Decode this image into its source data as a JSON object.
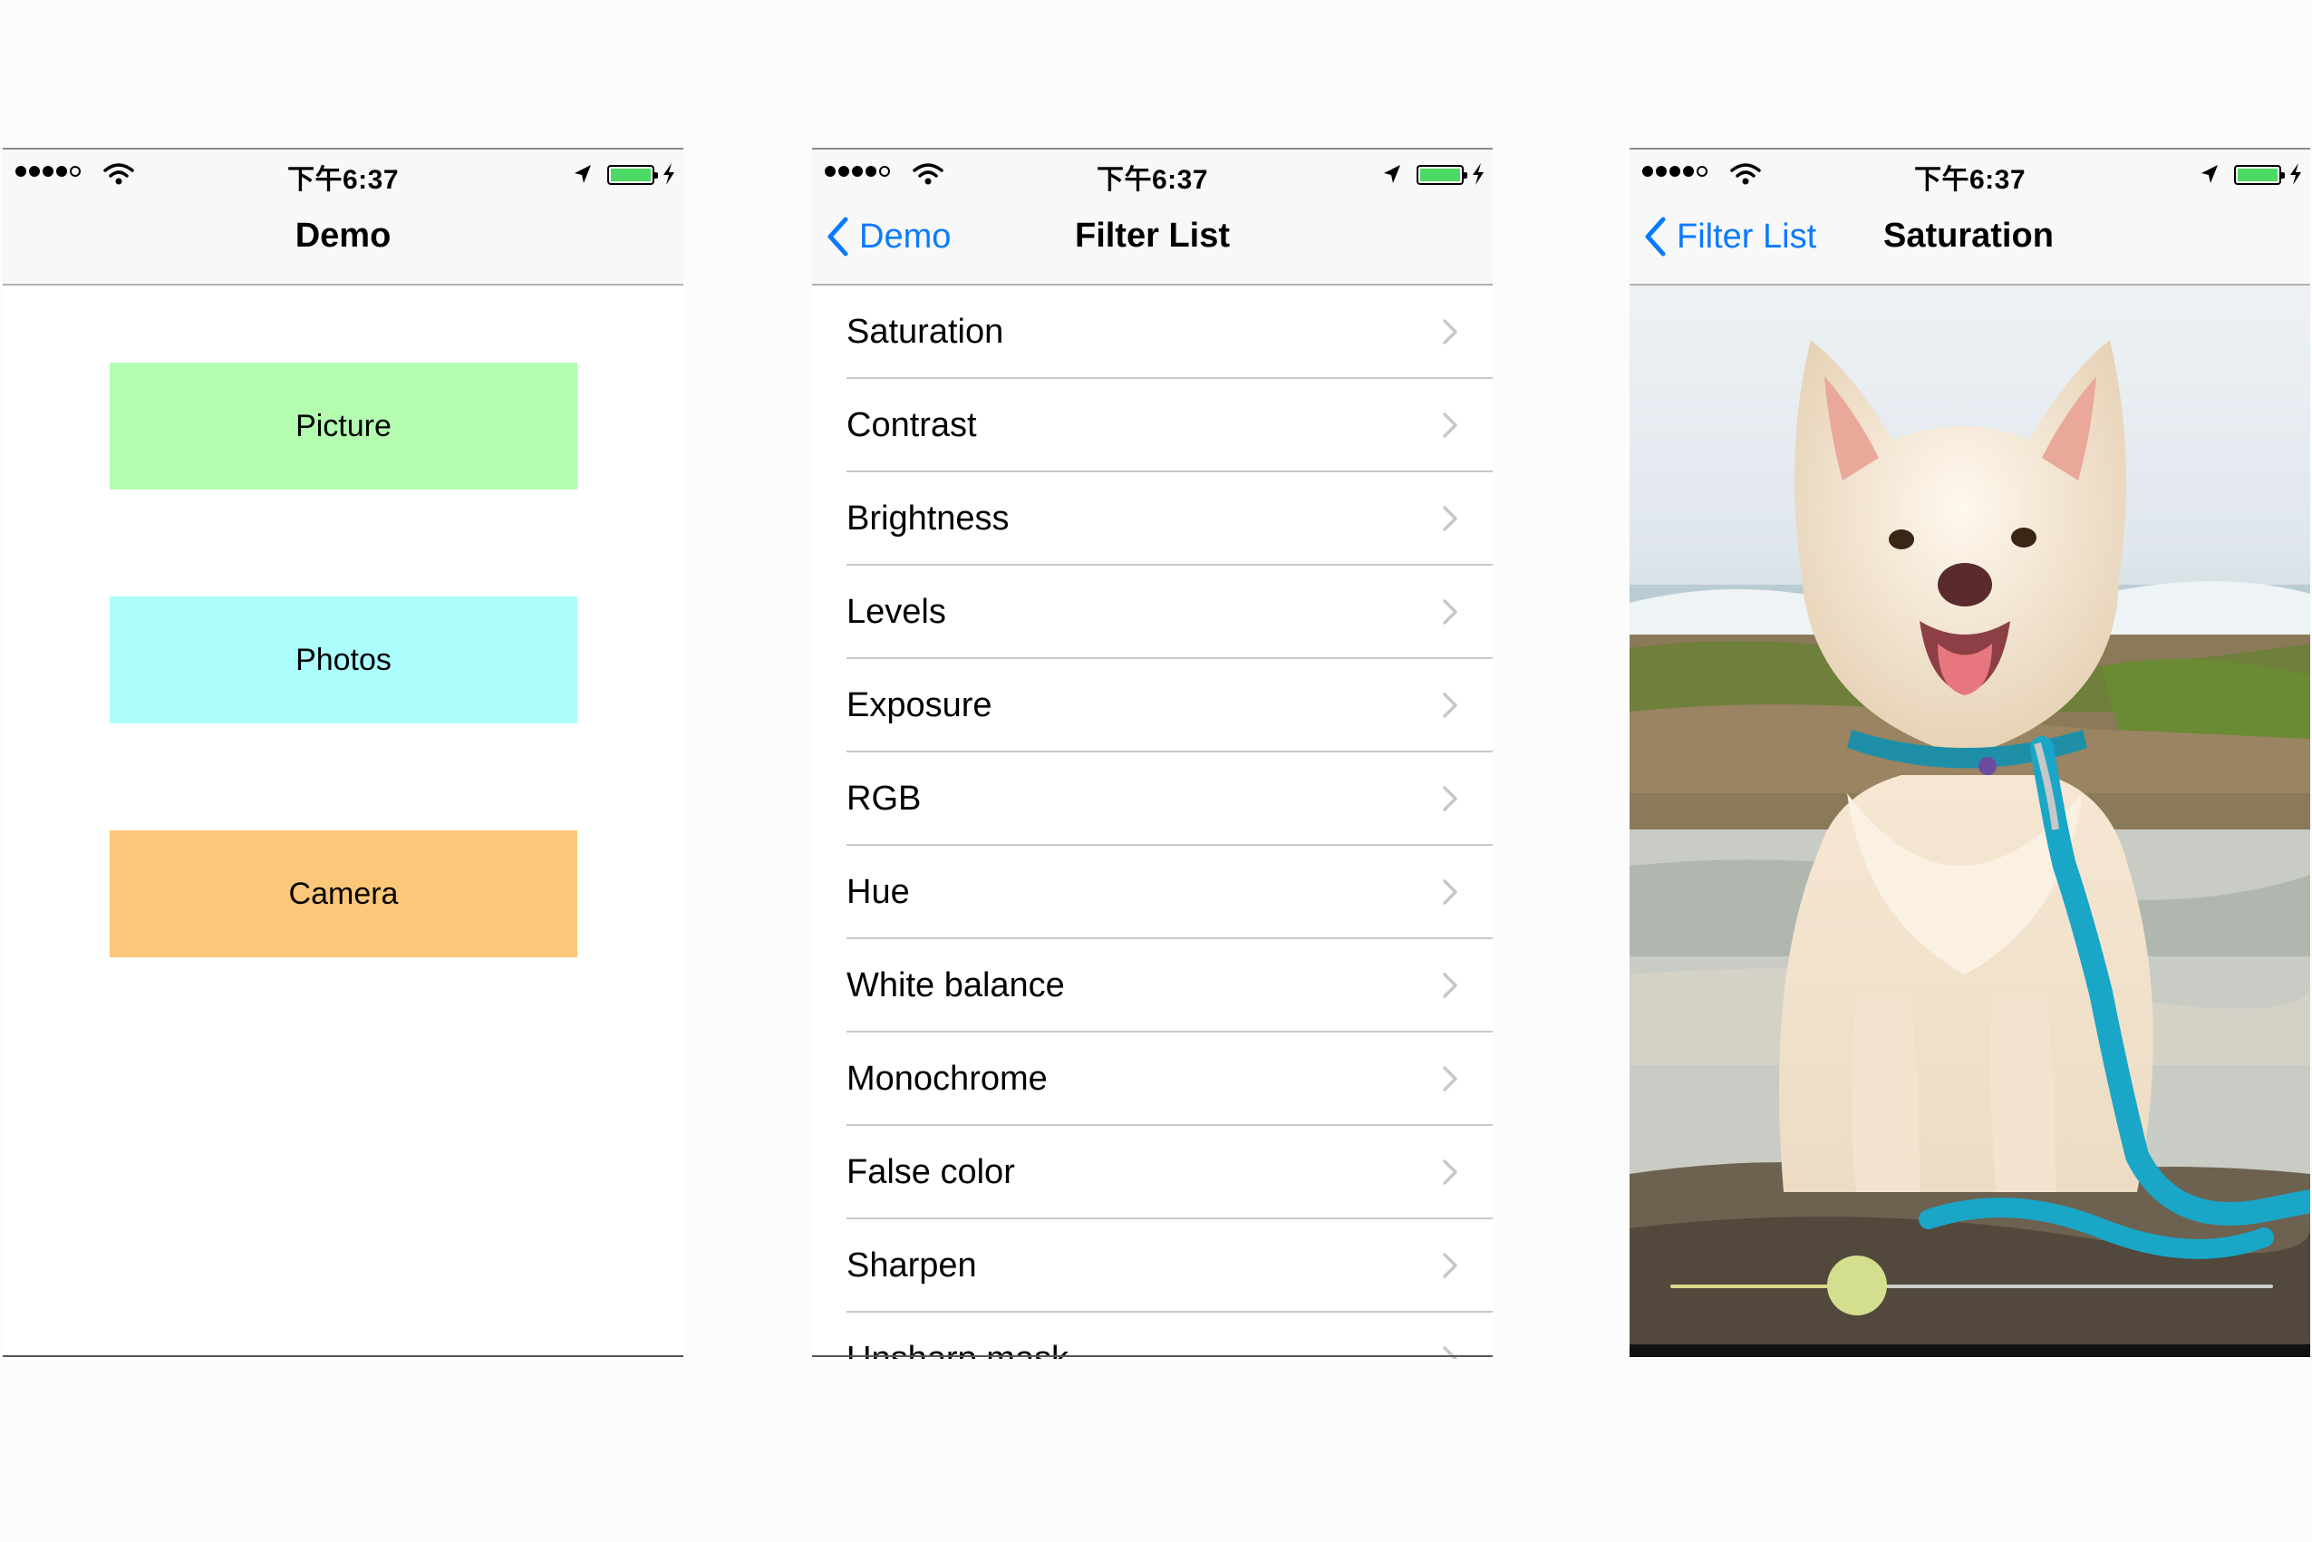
{
  "status_bar": {
    "time": "下午6:37"
  },
  "demo_screen": {
    "title": "Demo",
    "buttons": [
      {
        "label": "Picture",
        "color": "#b3fcb0"
      },
      {
        "label": "Photos",
        "color": "#abfefc"
      },
      {
        "label": "Camera",
        "color": "#fcc779"
      }
    ]
  },
  "filter_screen": {
    "back_label": "Demo",
    "title": "Filter List",
    "items": [
      "Saturation",
      "Contrast",
      "Brightness",
      "Levels",
      "Exposure",
      "RGB",
      "Hue",
      "White balance",
      "Monochrome",
      "False color",
      "Sharpen",
      "Unsharp mask"
    ]
  },
  "saturation_screen": {
    "back_label": "Filter List",
    "title": "Saturation",
    "slider_value": 0.31
  },
  "colors": {
    "accent": "#0a7aff",
    "battery": "#4cd964",
    "slider_thumb": "#d4de8f"
  }
}
